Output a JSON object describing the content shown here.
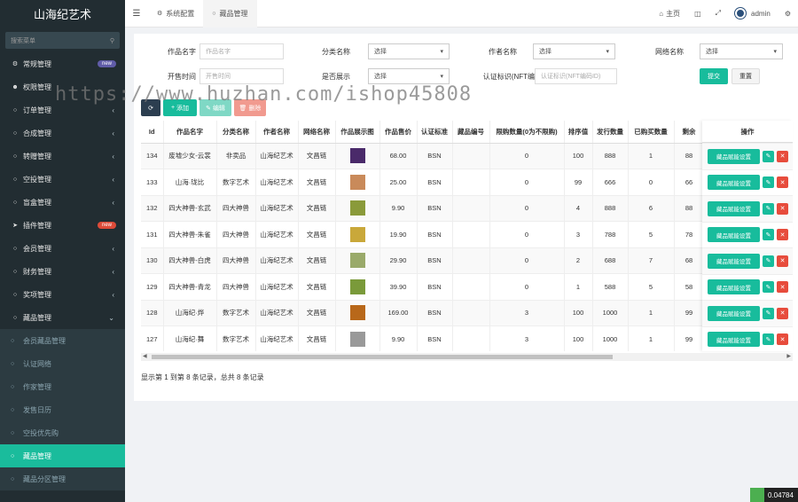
{
  "sidebar": {
    "brand": "山海纪艺术",
    "search_placeholder": "搜索菜单",
    "items": [
      {
        "label": "常规管理",
        "icon": "cogs-icon",
        "badge": "new",
        "badge_color": "#605ca8",
        "chev": false
      },
      {
        "label": "权限管理",
        "icon": "users-icon",
        "chev": false
      },
      {
        "label": "订单管理",
        "icon": "circle-icon",
        "chev": true
      },
      {
        "label": "合成管理",
        "icon": "circle-icon",
        "chev": true
      },
      {
        "label": "转赠管理",
        "icon": "circle-icon",
        "chev": true
      },
      {
        "label": "空投管理",
        "icon": "circle-icon",
        "chev": true
      },
      {
        "label": "盲盒管理",
        "icon": "circle-icon",
        "chev": true
      },
      {
        "label": "插件管理",
        "icon": "rocket-icon",
        "badge": "new",
        "badge_color": "#dd4b39",
        "chev": false
      },
      {
        "label": "会员管理",
        "icon": "circle-icon",
        "chev": true
      },
      {
        "label": "财务管理",
        "icon": "circle-icon",
        "chev": true
      },
      {
        "label": "奖项管理",
        "icon": "circle-icon",
        "chev": true
      },
      {
        "label": "藏品管理",
        "icon": "circle-icon",
        "chev": "down"
      }
    ],
    "subitems": [
      {
        "label": "会员藏品管理",
        "active": false
      },
      {
        "label": "认证网络",
        "active": false
      },
      {
        "label": "作家管理",
        "active": false
      },
      {
        "label": "发售日历",
        "active": false
      },
      {
        "label": "空投优先购",
        "active": false
      },
      {
        "label": "藏品管理",
        "active": true
      },
      {
        "label": "藏品分区管理",
        "active": false
      }
    ]
  },
  "topbar": {
    "tabs": [
      {
        "label": "系统配置",
        "icon": "gear-icon",
        "active": false
      },
      {
        "label": "藏品管理",
        "icon": "circle-icon",
        "active": true
      }
    ],
    "home_label": "主页",
    "user": "admin"
  },
  "filters": {
    "name_label": "作品名字",
    "name_placeholder": "作品名字",
    "category_label": "分类名称",
    "category_value": "选择",
    "author_label": "作者名称",
    "author_value": "选择",
    "network_label": "网络名称",
    "network_value": "选择",
    "open_time_label": "开售时间",
    "open_time_placeholder": "开售时间",
    "show_label": "是否展示",
    "show_value": "选择",
    "cert_label": "认证标识(NFT编",
    "cert_placeholder": "认证标识(NFT编码ID)",
    "submit": "提交",
    "reset": "重置"
  },
  "toolbar": {
    "add": "添加",
    "edit": "编辑",
    "delete": "删除"
  },
  "table": {
    "headers": [
      "Id",
      "作品名字",
      "分类名称",
      "作者名称",
      "网络名称",
      "作品展示图",
      "作品售价",
      "认证标准",
      "藏品编号",
      "限购数量(0为不限购)",
      "排序值",
      "发行数量",
      "已购买数量",
      "剩余"
    ],
    "ops_header": "操作",
    "ops_button": "藏品赋能设置",
    "rows": [
      {
        "id": "134",
        "name": "废墟少女-云裳",
        "cat": "非卖品",
        "author": "山海纪艺术",
        "net": "文昌链",
        "img": "#4a2a6a",
        "price": "68.00",
        "std": "BSN",
        "no": "",
        "limit": "0",
        "sort": "100",
        "issue": "888",
        "bought": "1",
        "left": "88"
      },
      {
        "id": "133",
        "name": "山海·珑比",
        "cat": "数字艺术",
        "author": "山海纪艺术",
        "net": "文昌链",
        "img": "#c98a5a",
        "price": "25.00",
        "std": "BSN",
        "no": "",
        "limit": "0",
        "sort": "99",
        "issue": "666",
        "bought": "0",
        "left": "66"
      },
      {
        "id": "132",
        "name": "四大神兽-玄武",
        "cat": "四大神兽",
        "author": "山海纪艺术",
        "net": "文昌链",
        "img": "#8a9a3a",
        "price": "9.90",
        "std": "BSN",
        "no": "",
        "limit": "0",
        "sort": "4",
        "issue": "888",
        "bought": "6",
        "left": "88"
      },
      {
        "id": "131",
        "name": "四大神兽-朱雀",
        "cat": "四大神兽",
        "author": "山海纪艺术",
        "net": "文昌链",
        "img": "#c9a83a",
        "price": "19.90",
        "std": "BSN",
        "no": "",
        "limit": "0",
        "sort": "3",
        "issue": "788",
        "bought": "5",
        "left": "78"
      },
      {
        "id": "130",
        "name": "四大神兽-白虎",
        "cat": "四大神兽",
        "author": "山海纪艺术",
        "net": "文昌链",
        "img": "#9aaa6a",
        "price": "29.90",
        "std": "BSN",
        "no": "",
        "limit": "0",
        "sort": "2",
        "issue": "688",
        "bought": "7",
        "left": "68"
      },
      {
        "id": "129",
        "name": "四大神兽-青龙",
        "cat": "四大神兽",
        "author": "山海纪艺术",
        "net": "文昌链",
        "img": "#7a9a3a",
        "price": "39.90",
        "std": "BSN",
        "no": "",
        "limit": "0",
        "sort": "1",
        "issue": "588",
        "bought": "5",
        "left": "58"
      },
      {
        "id": "128",
        "name": "山海纪·烨",
        "cat": "数字艺术",
        "author": "山海纪艺术",
        "net": "文昌链",
        "img": "#b8681a",
        "price": "169.00",
        "std": "BSN",
        "no": "",
        "limit": "3",
        "sort": "100",
        "issue": "1000",
        "bought": "1",
        "left": "99"
      },
      {
        "id": "127",
        "name": "山海纪·舞",
        "cat": "数字艺术",
        "author": "山海纪艺术",
        "net": "文昌链",
        "img": "#999999",
        "price": "9.90",
        "std": "BSN",
        "no": "",
        "limit": "3",
        "sort": "100",
        "issue": "1000",
        "bought": "1",
        "left": "99"
      }
    ]
  },
  "footer": "显示第 1 到第 8 条记录，总共 8 条记录",
  "watermark": "https://www.huzhan.com/ishop45808",
  "corner_value": "0.04784",
  "colors": {
    "accent": "#18bc9c",
    "danger": "#e74c3c",
    "sidebar": "#222d32"
  }
}
